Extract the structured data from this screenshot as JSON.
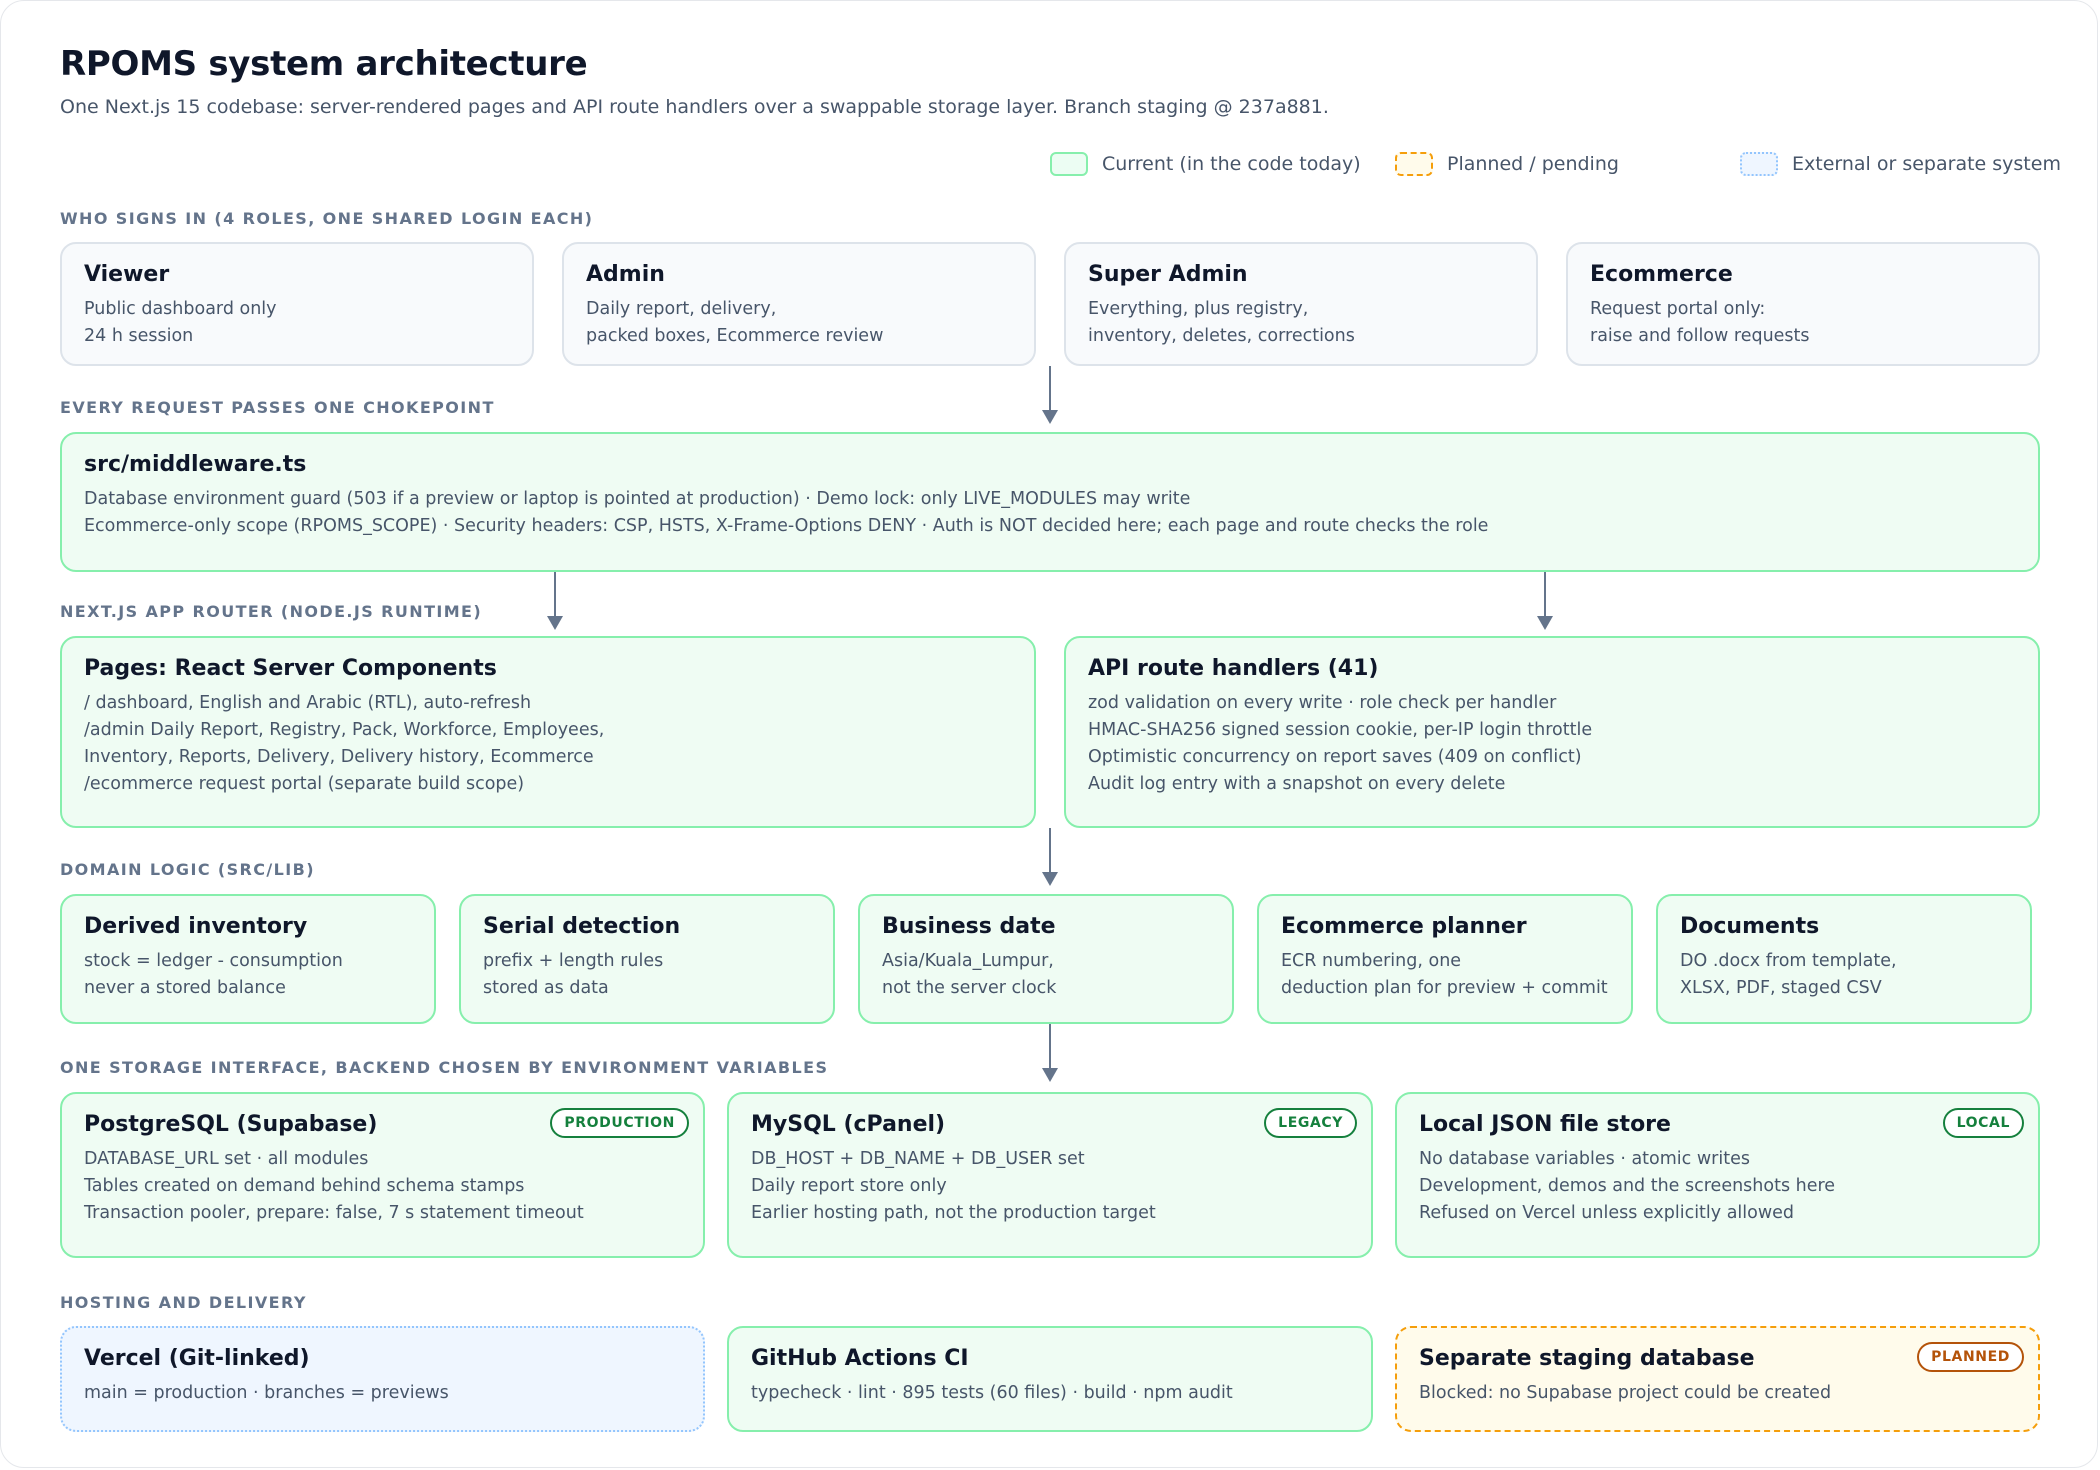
{
  "header": {
    "title": "RPOMS system architecture",
    "subtitle": "One Next.js 15 codebase: server-rendered pages and API route handlers over a swappable storage layer. Branch staging @ 237a881."
  },
  "legend": {
    "current": "Current (in the code today)",
    "planned": "Planned / pending",
    "external": "External or separate system"
  },
  "sections": {
    "roles": "WHO SIGNS IN (4 ROLES, ONE SHARED LOGIN EACH)",
    "chokepoint": "EVERY REQUEST PASSES ONE CHOKEPOINT",
    "router": "NEXT.JS APP ROUTER (NODE.JS RUNTIME)",
    "domain": "DOMAIN LOGIC (SRC/LIB)",
    "storage": "ONE STORAGE INTERFACE, BACKEND CHOSEN BY ENVIRONMENT VARIABLES",
    "hosting": "HOSTING AND DELIVERY"
  },
  "roles": [
    {
      "title": "Viewer",
      "lines": [
        "Public dashboard only",
        "24 h session"
      ]
    },
    {
      "title": "Admin",
      "lines": [
        "Daily report, delivery,",
        "packed boxes, Ecommerce review"
      ]
    },
    {
      "title": "Super Admin",
      "lines": [
        "Everything, plus registry,",
        "inventory, deletes, corrections"
      ]
    },
    {
      "title": "Ecommerce",
      "lines": [
        "Request portal only:",
        "raise and follow requests"
      ]
    }
  ],
  "middleware": {
    "title": "src/middleware.ts",
    "lines": [
      "Database environment guard (503 if a preview or laptop is pointed at production) · Demo lock: only LIVE_MODULES may write",
      "Ecommerce-only scope (RPOMS_SCOPE) · Security headers: CSP, HSTS, X-Frame-Options DENY · Auth is NOT decided here; each page and route checks the role"
    ]
  },
  "router": {
    "pages": {
      "title": "Pages: React Server Components",
      "lines": [
        "/ dashboard, English and Arabic (RTL), auto-refresh",
        "/admin Daily Report, Registry, Pack, Workforce, Employees,",
        "Inventory, Reports, Delivery, Delivery history, Ecommerce",
        "/ecommerce request portal (separate build scope)"
      ]
    },
    "api": {
      "title": "API route handlers (41)",
      "lines": [
        "zod validation on every write · role check per handler",
        "HMAC-SHA256 signed session cookie, per-IP login throttle",
        "Optimistic concurrency on report saves (409 on conflict)",
        "Audit log entry with a snapshot on every delete"
      ]
    }
  },
  "domain": [
    {
      "title": "Derived inventory",
      "lines": [
        "stock = ledger - consumption",
        "never a stored balance"
      ]
    },
    {
      "title": "Serial detection",
      "lines": [
        "prefix + length rules",
        "stored as data"
      ]
    },
    {
      "title": "Business date",
      "lines": [
        "Asia/Kuala_Lumpur,",
        "not the server clock"
      ]
    },
    {
      "title": "Ecommerce planner",
      "lines": [
        "ECR numbering, one",
        "deduction plan for preview + commit"
      ]
    },
    {
      "title": "Documents",
      "lines": [
        "DO .docx from template,",
        "XLSX, PDF, staged CSV"
      ]
    }
  ],
  "storage": [
    {
      "title": "PostgreSQL (Supabase)",
      "badge": "PRODUCTION",
      "lines": [
        "DATABASE_URL set · all modules",
        "Tables created on demand behind schema stamps",
        "Transaction pooler, prepare: false, 7 s statement timeout"
      ]
    },
    {
      "title": "MySQL (cPanel)",
      "badge": "LEGACY",
      "lines": [
        "DB_HOST + DB_NAME + DB_USER set",
        "Daily report store only",
        "Earlier hosting path, not the production target"
      ]
    },
    {
      "title": "Local JSON file store",
      "badge": "LOCAL",
      "lines": [
        "No database variables · atomic writes",
        "Development, demos and the screenshots here",
        "Refused on Vercel unless explicitly allowed"
      ]
    }
  ],
  "hosting": [
    {
      "title": "Vercel (Git-linked)",
      "lines": [
        "main = production · branches = previews"
      ]
    },
    {
      "title": "GitHub Actions CI",
      "lines": [
        "typecheck · lint · 895 tests (60 files) · build · npm audit"
      ]
    },
    {
      "title": "Separate staging database",
      "badge": "PLANNED",
      "lines": [
        "Blocked: no Supabase project could be created"
      ]
    }
  ],
  "colors": {
    "current_border": "#86efac",
    "current_fill": "#effcf3",
    "planned_border": "#f59e0b",
    "planned_fill": "#fffbeb",
    "external_border": "#93c5fd",
    "external_fill": "#eff6ff",
    "arrow": "#64748b"
  }
}
